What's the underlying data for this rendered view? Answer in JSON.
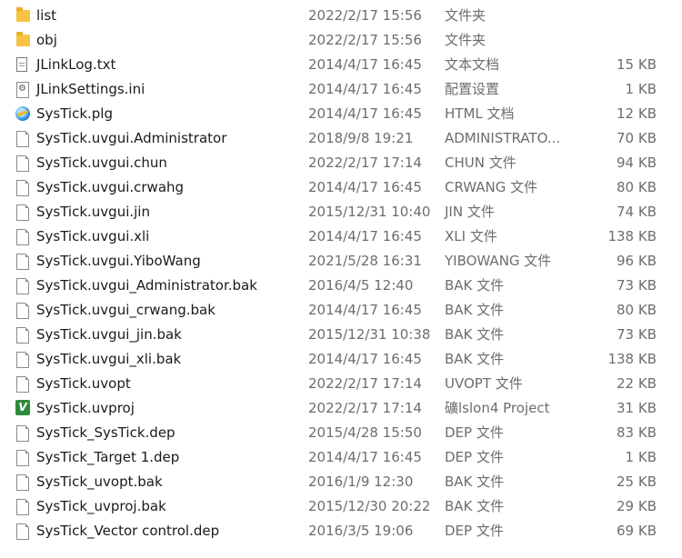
{
  "files": [
    {
      "icon": "folder-icon",
      "name": "list",
      "date": "2022/2/17 15:56",
      "type": "文件夹",
      "size": ""
    },
    {
      "icon": "folder-icon",
      "name": "obj",
      "date": "2022/2/17 15:56",
      "type": "文件夹",
      "size": ""
    },
    {
      "icon": "text-file-icon",
      "name": "JLinkLog.txt",
      "date": "2014/4/17 16:45",
      "type": "文本文档",
      "size": "15 KB"
    },
    {
      "icon": "settings-file-icon",
      "name": "JLinkSettings.ini",
      "date": "2014/4/17 16:45",
      "type": "配置设置",
      "size": "1 KB"
    },
    {
      "icon": "html-file-icon",
      "name": "SysTick.plg",
      "date": "2014/4/17 16:45",
      "type": "HTML 文档",
      "size": "12 KB"
    },
    {
      "icon": "file-icon",
      "name": "SysTick.uvgui.Administrator",
      "date": "2018/9/8 19:21",
      "type": "ADMINISTRATO...",
      "size": "70 KB"
    },
    {
      "icon": "file-icon",
      "name": "SysTick.uvgui.chun",
      "date": "2022/2/17 17:14",
      "type": "CHUN 文件",
      "size": "94 KB"
    },
    {
      "icon": "file-icon",
      "name": "SysTick.uvgui.crwahg",
      "date": "2014/4/17 16:45",
      "type": "CRWANG 文件",
      "size": "80 KB"
    },
    {
      "icon": "file-icon",
      "name": "SysTick.uvgui.jin",
      "date": "2015/12/31 10:40",
      "type": "JIN 文件",
      "size": "74 KB"
    },
    {
      "icon": "file-icon",
      "name": "SysTick.uvgui.xli",
      "date": "2014/4/17 16:45",
      "type": "XLI 文件",
      "size": "138 KB"
    },
    {
      "icon": "file-icon",
      "name": "SysTick.uvgui.YiboWang",
      "date": "2021/5/28 16:31",
      "type": "YIBOWANG 文件",
      "size": "96 KB"
    },
    {
      "icon": "file-icon",
      "name": "SysTick.uvgui_Administrator.bak",
      "date": "2016/4/5 12:40",
      "type": "BAK 文件",
      "size": "73 KB"
    },
    {
      "icon": "file-icon",
      "name": "SysTick.uvgui_crwang.bak",
      "date": "2014/4/17 16:45",
      "type": "BAK 文件",
      "size": "80 KB"
    },
    {
      "icon": "file-icon",
      "name": "SysTick.uvgui_jin.bak",
      "date": "2015/12/31 10:38",
      "type": "BAK 文件",
      "size": "73 KB"
    },
    {
      "icon": "file-icon",
      "name": "SysTick.uvgui_xli.bak",
      "date": "2014/4/17 16:45",
      "type": "BAK 文件",
      "size": "138 KB"
    },
    {
      "icon": "file-icon",
      "name": "SysTick.uvopt",
      "date": "2022/2/17 17:14",
      "type": "UVOPT 文件",
      "size": "22 KB"
    },
    {
      "icon": "uvision-project-icon",
      "name": "SysTick.uvproj",
      "date": "2022/2/17 17:14",
      "type": "礦lslon4 Project",
      "size": "31 KB"
    },
    {
      "icon": "file-icon",
      "name": "SysTick_SysTick.dep",
      "date": "2015/4/28 15:50",
      "type": "DEP 文件",
      "size": "83 KB"
    },
    {
      "icon": "file-icon",
      "name": "SysTick_Target 1.dep",
      "date": "2014/4/17 16:45",
      "type": "DEP 文件",
      "size": "1 KB"
    },
    {
      "icon": "file-icon",
      "name": "SysTick_uvopt.bak",
      "date": "2016/1/9 12:30",
      "type": "BAK 文件",
      "size": "25 KB"
    },
    {
      "icon": "file-icon",
      "name": "SysTick_uvproj.bak",
      "date": "2015/12/30 20:22",
      "type": "BAK 文件",
      "size": "29 KB"
    },
    {
      "icon": "file-icon",
      "name": "SysTick_Vector control.dep",
      "date": "2016/3/5 19:06",
      "type": "DEP 文件",
      "size": "69 KB"
    }
  ]
}
